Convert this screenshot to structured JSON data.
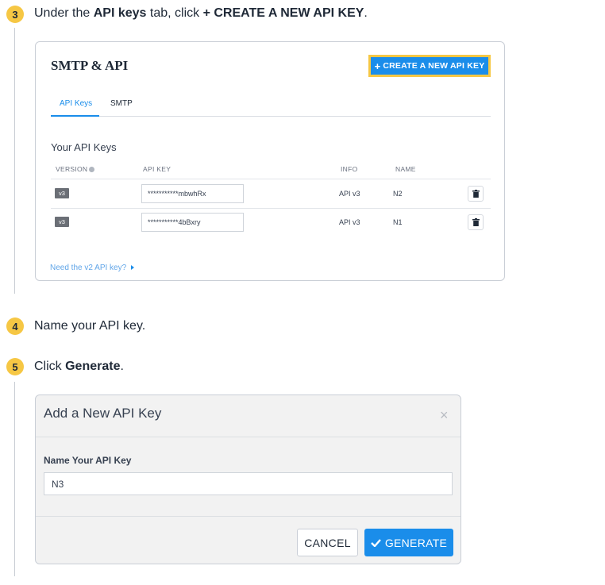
{
  "steps": [
    {
      "number": "3",
      "pre": "Under the ",
      "bold1": "API keys",
      "mid": " tab, click ",
      "bold2": "+ CREATE A NEW API KEY",
      "post": "."
    },
    {
      "number": "4",
      "text": "Name your API key."
    },
    {
      "number": "5",
      "pre": "Click ",
      "bold": "Generate",
      "post": "."
    }
  ],
  "smtp_panel": {
    "title": "SMTP & API",
    "create_button": "CREATE A NEW API KEY",
    "create_button_icon": "+",
    "tabs": [
      {
        "label": "API Keys",
        "active": true
      },
      {
        "label": "SMTP",
        "active": false
      }
    ],
    "section_title": "Your API Keys",
    "columns": [
      "VERSION",
      "API KEY",
      "INFO",
      "NAME"
    ],
    "rows": [
      {
        "version": "v3",
        "api_key": "***********mbwhRx",
        "info": "API v3",
        "name": "N2"
      },
      {
        "version": "v3",
        "api_key": "***********4bBxry",
        "info": "API v3",
        "name": "N1"
      }
    ],
    "v2_link": "Need the v2 API key?"
  },
  "add_key_modal": {
    "title": "Add a New API Key",
    "close_icon": "×",
    "field_label": "Name Your API Key",
    "field_value": "N3",
    "cancel_label": "CANCEL",
    "generate_label": "GENERATE"
  },
  "colors": {
    "accent_blue": "#1a8dea",
    "step_badge": "#f6c744",
    "highlight_border": "#f6c744"
  }
}
